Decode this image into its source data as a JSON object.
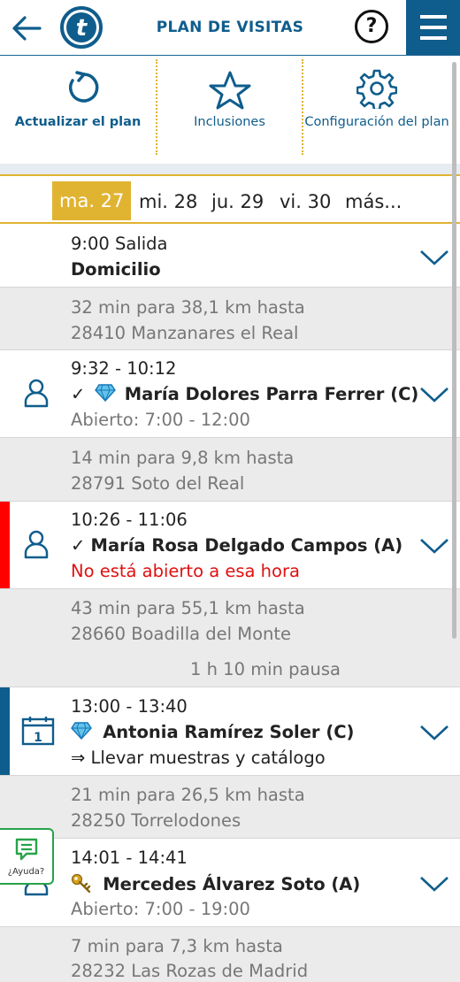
{
  "header": {
    "title": "PLAN DE VISITAS",
    "help_symbol": "?",
    "back_icon": "arrow-left-icon",
    "logo_letter": "t"
  },
  "toolbar": {
    "items": [
      {
        "label": "Actualizar el plan",
        "icon": "refresh-icon"
      },
      {
        "label": "Inclusiones",
        "icon": "star-icon"
      },
      {
        "label": "Configuración del plan",
        "icon": "gear-icon"
      }
    ]
  },
  "dates": {
    "days": [
      "ma. 27",
      "mi. 28",
      "ju. 29",
      "vi. 30",
      "más..."
    ],
    "selected": "ma. 27",
    "accent": "#e0b331"
  },
  "plan": {
    "start": {
      "time": "9:00 Salida",
      "place": "Domicilio"
    },
    "travel1": {
      "duration": "32 min para 38,1 km hasta",
      "destination": "28410 Manzanares el Real"
    },
    "visit1": {
      "time": "9:32 - 10:12",
      "name": "María Dolores Parra Ferrer (C)",
      "prefix": "✓",
      "hours": "Abierto: 7:00 - 12:00"
    },
    "travel2": {
      "duration": "14 min para 9,8 km hasta",
      "destination": "28791 Soto del Real"
    },
    "visit2": {
      "time": "10:26 - 11:06",
      "name": "María Rosa Delgado Campos (A)",
      "prefix": "✓",
      "warning": "No está abierto a esa hora",
      "marker_color": "#ff0000"
    },
    "travel3": {
      "duration": "43 min para 55,1 km hasta",
      "destination": "28660 Boadilla del Monte"
    },
    "pause": "1 h 10 min pausa",
    "visit3": {
      "time": "13:00 - 13:40",
      "name": "Antonia Ramírez Soler (C)",
      "note": "⇒ Llevar muestras y catálogo",
      "marker_color": "#0f5d8c",
      "calendar_day": "1"
    },
    "travel4": {
      "duration": "21 min para 26,5 km hasta",
      "destination": "28250 Torrelodones"
    },
    "visit4": {
      "time": "14:01 - 14:41",
      "name": "Mercedes Álvarez Soto (A)",
      "hours": "Abierto: 7:00 - 19:00"
    },
    "travel5": {
      "duration": "7 min para 7,3 km hasta",
      "destination": "28232 Las Rozas de Madrid"
    }
  },
  "help_widget": {
    "label": "¿Ayuda?"
  },
  "colors": {
    "primary": "#0f5d8c",
    "warning": "#e01010",
    "help_green": "#27a34a"
  }
}
